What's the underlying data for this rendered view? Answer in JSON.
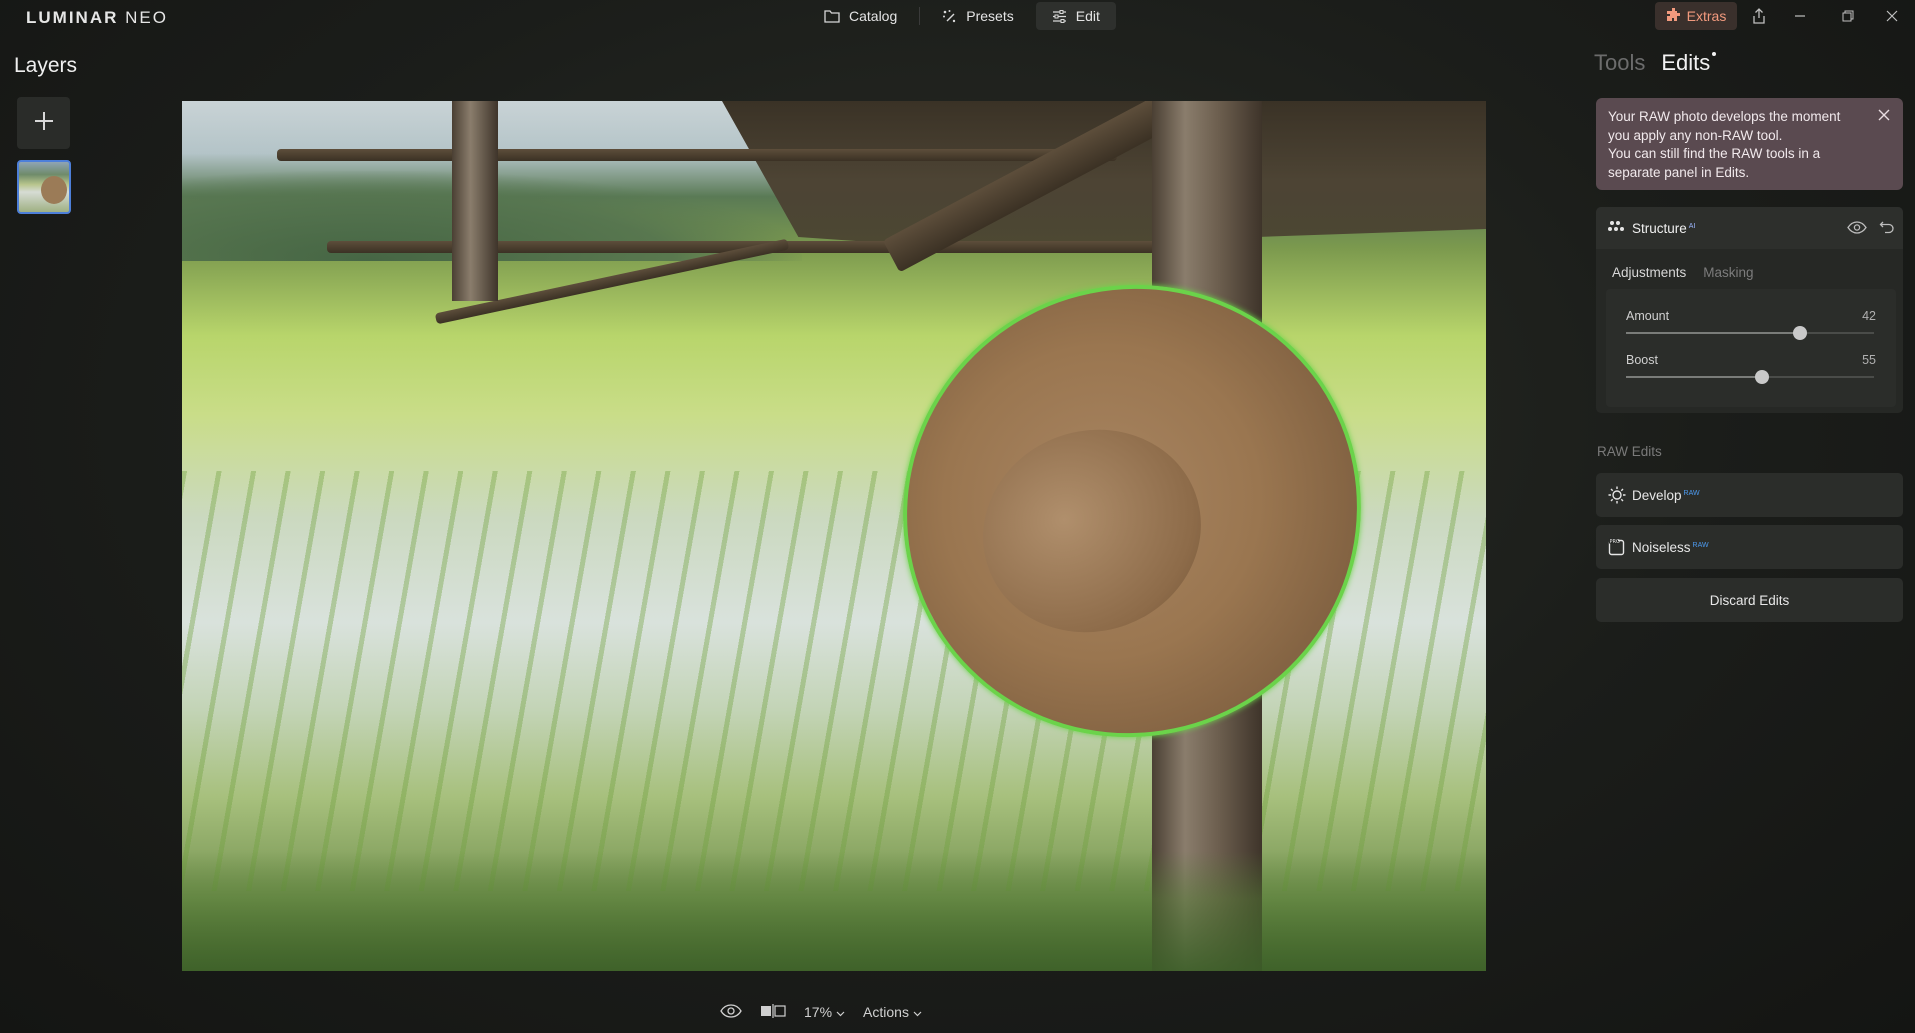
{
  "app": {
    "logo_main": "LUMINAR",
    "logo_accent": "NEO"
  },
  "modes": [
    {
      "label": "Catalog",
      "icon": "folder-icon"
    },
    {
      "label": "Presets",
      "icon": "presets-icon"
    },
    {
      "label": "Edit",
      "icon": "sliders-icon",
      "active": true
    }
  ],
  "extras": {
    "label": "Extras",
    "color": "#f29a7e"
  },
  "window_controls": [
    "share-icon",
    "minimize-icon",
    "restore-icon",
    "close-icon"
  ],
  "layers": {
    "title": "Layers"
  },
  "bottom_bar": {
    "zoom": "17%",
    "actions": "Actions"
  },
  "panel": {
    "tabs": [
      {
        "label": "Tools",
        "active": false
      },
      {
        "label": "Edits",
        "active": true
      }
    ],
    "notice": {
      "line1": "Your RAW photo develops the moment",
      "line2": "you apply any non-RAW tool.",
      "line3": "You can still find the RAW tools in a",
      "line4": "separate panel in Edits."
    },
    "tool": {
      "name": "Structure",
      "badge": "AI",
      "subtabs": [
        {
          "label": "Adjustments",
          "active": true
        },
        {
          "label": "Masking",
          "active": false
        }
      ],
      "sliders": [
        {
          "label": "Amount",
          "value": "42",
          "fraction": 0.7
        },
        {
          "label": "Boost",
          "value": "55",
          "fraction": 0.55
        }
      ]
    },
    "raw_section_title": "RAW Edits",
    "raw_tools": [
      {
        "label": "Develop",
        "badge": "RAW",
        "icon": "sun-icon"
      },
      {
        "label": "Noiseless",
        "badge": "RAW",
        "icon": "noiseless-icon"
      }
    ],
    "discard_label": "Discard Edits"
  },
  "colors": {
    "accent_blue": "#4d7fd9",
    "mask_green": "#6bd34a",
    "notice_bg": "#5a4a50"
  }
}
